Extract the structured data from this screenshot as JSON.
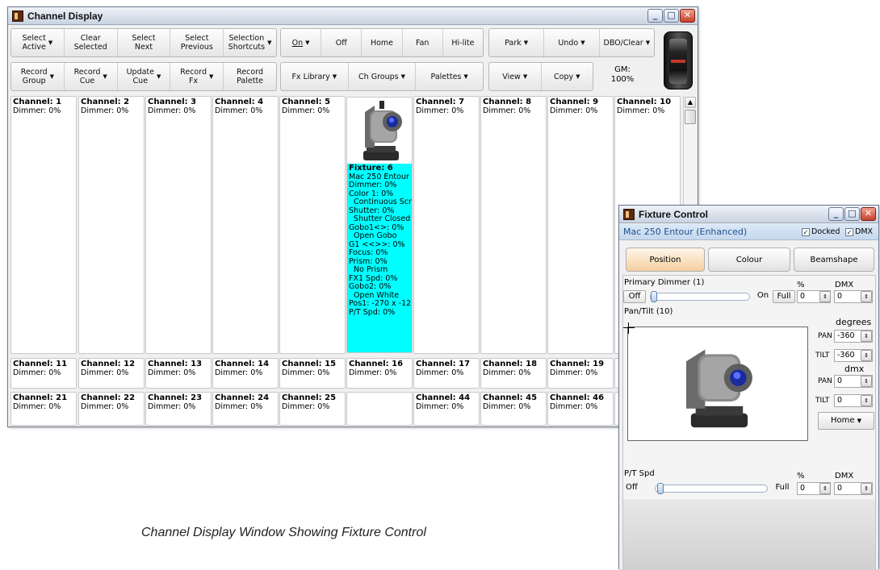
{
  "channel_display": {
    "title": "Channel Display",
    "toolbar_row1": {
      "group1": [
        "Select\nActive",
        "Clear\nSelected",
        "Select\nNext",
        "Select\nPrevious",
        "Selection\nShortcuts"
      ],
      "group2": [
        "On",
        "Off",
        "Home",
        "Fan",
        "Hi-lite"
      ],
      "group3": [
        "Park",
        "Undo",
        "DBO/Clear"
      ]
    },
    "toolbar_row2": {
      "group1": [
        "Record\nGroup",
        "Record\nCue",
        "Update\nCue",
        "Record\nFx",
        "Record\nPalette"
      ],
      "group2": [
        "Fx Library",
        "Ch Groups",
        "Palettes"
      ],
      "group3": [
        "View",
        "Copy"
      ],
      "gm_label": "GM:",
      "gm_value": "100%"
    },
    "row1": [
      {
        "name": "Channel: 1",
        "value": "Dimmer: 0%"
      },
      {
        "name": "Channel: 2",
        "value": "Dimmer: 0%"
      },
      {
        "name": "Channel: 3",
        "value": "Dimmer: 0%"
      },
      {
        "name": "Channel: 4",
        "value": "Dimmer: 0%"
      },
      {
        "name": "Channel: 5",
        "value": "Dimmer: 0%"
      },
      {
        "name": "",
        "value": ""
      },
      {
        "name": "Channel: 7",
        "value": "Dimmer: 0%"
      },
      {
        "name": "Channel: 8",
        "value": "Dimmer: 0%"
      },
      {
        "name": "Channel: 9",
        "value": "Dimmer: 0%"
      },
      {
        "name": "Channel: 10",
        "value": "Dimmer: 0%"
      }
    ],
    "fixture": {
      "title": "Fixture: 6",
      "lines": [
        "Mac 250 Entour (",
        "Dimmer: 0%",
        "Color 1: 0%",
        "  Continuous Scr",
        "Shutter: 0%",
        "  Shutter Closed",
        "Gobo1<>: 0%",
        "  Open Gobo",
        "G1 <<>>: 0%",
        "Focus: 0%",
        "Prism: 0%",
        "  No Prism",
        "FX1 Spd: 0%",
        "Gobo2: 0%",
        "  Open White",
        "Pos1: -270 x -12",
        "P/T Spd: 0%"
      ]
    },
    "row2": [
      {
        "name": "Channel: 11",
        "value": "Dimmer: 0%"
      },
      {
        "name": "Channel: 12",
        "value": "Dimmer: 0%"
      },
      {
        "name": "Channel: 13",
        "value": "Dimmer: 0%"
      },
      {
        "name": "Channel: 14",
        "value": "Dimmer: 0%"
      },
      {
        "name": "Channel: 15",
        "value": "Dimmer: 0%"
      },
      {
        "name": "Channel: 16",
        "value": "Dimmer: 0%"
      },
      {
        "name": "Channel: 17",
        "value": "Dimmer: 0%"
      },
      {
        "name": "Channel: 18",
        "value": "Dimmer: 0%"
      },
      {
        "name": "Channel: 19",
        "value": "Dimmer: 0%"
      }
    ],
    "row3": [
      {
        "name": "Channel: 21",
        "value": "Dimmer: 0%"
      },
      {
        "name": "Channel: 22",
        "value": "Dimmer: 0%"
      },
      {
        "name": "Channel: 23",
        "value": "Dimmer: 0%"
      },
      {
        "name": "Channel: 24",
        "value": "Dimmer: 0%"
      },
      {
        "name": "Channel: 25",
        "value": "Dimmer: 0%"
      },
      {
        "name": "",
        "value": ""
      },
      {
        "name": "Channel: 44",
        "value": "Dimmer: 0%"
      },
      {
        "name": "Channel: 45",
        "value": "Dimmer: 0%"
      },
      {
        "name": "Channel: 46",
        "value": "Dimmer: 0%"
      }
    ]
  },
  "fixture_control": {
    "title": "Fixture Control",
    "fixture_name": "Mac 250 Entour (Enhanced)",
    "docked_label": "Docked",
    "dmx_label": "DMX",
    "tabs": [
      "Position",
      "Colour",
      "Beamshape"
    ],
    "primary_dimmer_label": "Primary Dimmer (1)",
    "pct_label": "%",
    "dmx_col_label": "DMX",
    "off_label": "Off",
    "on_label": "On",
    "full_label": "Full",
    "dimmer_pct": "0",
    "dimmer_dmx": "0",
    "pantilt_label": "Pan/Tilt (10)",
    "degrees_label": "degrees",
    "pan_label": "PAN",
    "tilt_label": "TILT",
    "pan_deg": "-360",
    "tilt_deg": "-360",
    "dmx_sub_label": "dmx",
    "pan_dmx": "0",
    "tilt_dmx": "0",
    "home_label": "Home",
    "pt_spd_label": "P/T Spd",
    "pt_pct": "0",
    "pt_dmx": "0"
  },
  "caption": "Channel Display Window Showing Fixture Control"
}
